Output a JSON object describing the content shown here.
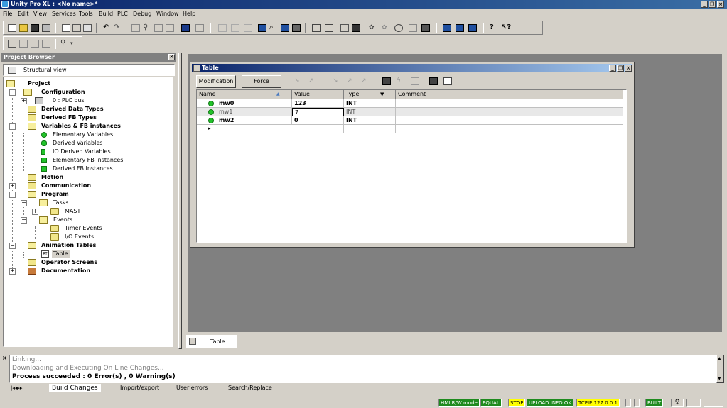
{
  "window": {
    "title": "Unity Pro XL : <No name>*"
  },
  "menu": [
    "File",
    "Edit",
    "View",
    "Services",
    "Tools",
    "Build",
    "PLC",
    "Debug",
    "Window",
    "Help"
  ],
  "project_browser": {
    "header": "Project Browser",
    "view_label": "Structural view",
    "tree": {
      "project": "Project",
      "configuration": "Configuration",
      "plc_bus": "0 : PLC bus",
      "derived_data_types": "Derived Data Types",
      "derived_fb_types": "Derived FB Types",
      "variables": "Variables & FB instances",
      "elementary_vars": "Elementary Variables",
      "derived_vars": "Derived Variables",
      "io_derived_vars": "IO Derived Variables",
      "elementary_fb": "Elementary FB Instances",
      "derived_fb": "Derived FB Instances",
      "motion": "Motion",
      "communication": "Communication",
      "program": "Program",
      "tasks": "Tasks",
      "mast": "MAST",
      "events": "Events",
      "timer_events": "Timer Events",
      "io_events": "I/O Events",
      "animation_tables": "Animation Tables",
      "table": "Table",
      "operator_screens": "Operator Screens",
      "documentation": "Documentation"
    }
  },
  "table_window": {
    "title": "Table",
    "modification_button": "Modification",
    "force_button": "Force",
    "columns": [
      "Name",
      "Value",
      "Type",
      "Comment"
    ],
    "rows": [
      {
        "name": "mw0",
        "value": "123",
        "type": "INT",
        "comment": ""
      },
      {
        "name": "mw1",
        "value": "7",
        "type": "INT",
        "comment": ""
      },
      {
        "name": "mw2",
        "value": "0",
        "type": "INT",
        "comment": ""
      }
    ]
  },
  "doc_tab": "Table",
  "output": {
    "lines": [
      "Linking...",
      "Downloading and Executing On Line Changes...",
      "Process succeeded  : 0 Error(s) , 0 Warning(s)"
    ],
    "tabs": [
      "Build Changes",
      "Import/export",
      "User errors",
      "Search/Replace"
    ]
  },
  "status": {
    "hmi": "HMI R/W mode",
    "equal": "EQUAL",
    "stop": "STOP",
    "upload": "UPLOAD INFO OK",
    "tcpip": "TCPIP:127.0.0.1",
    "built": "BUILT"
  },
  "colors": {
    "status_green": "#1f8b1f",
    "status_yellow": "#ffff00",
    "title_blue": "#0a246a"
  }
}
